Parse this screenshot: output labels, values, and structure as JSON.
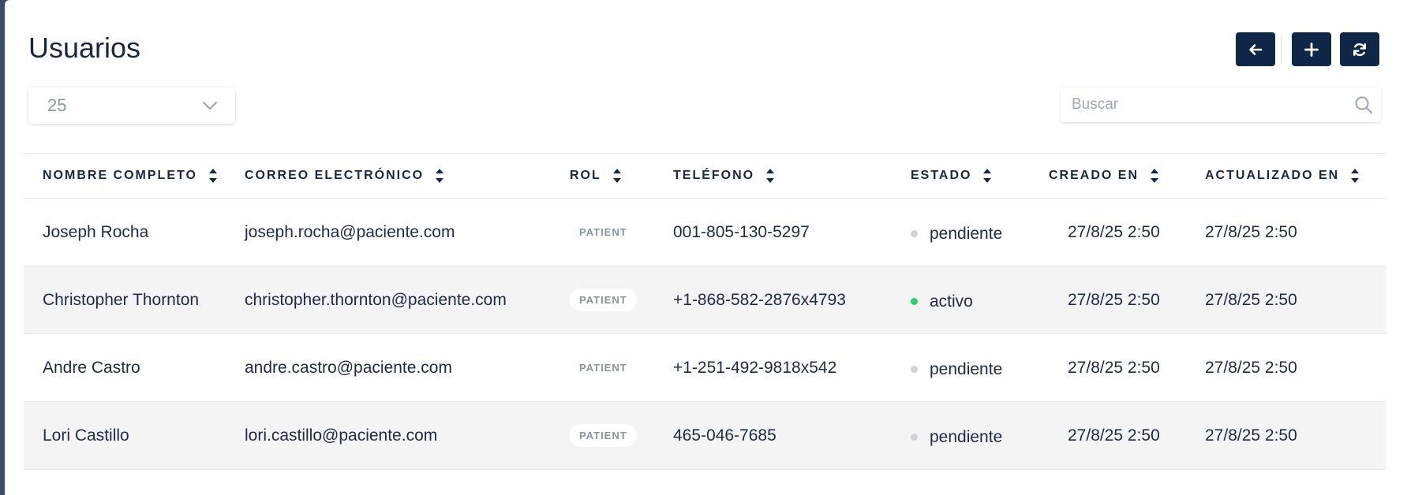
{
  "header": {
    "title": "Usuarios"
  },
  "toolbar": {
    "back_icon": "arrow-left-icon",
    "add_icon": "plus-icon",
    "refresh_icon": "refresh-icon"
  },
  "page_size": {
    "value": "25"
  },
  "search": {
    "placeholder": "Buscar",
    "value": ""
  },
  "table": {
    "columns": [
      "NOMBRE COMPLETO",
      "CORREO ELECTRÓNICO",
      "ROL",
      "TELÉFONO",
      "ESTADO",
      "CREADO EN",
      "ACTUALIZADO EN"
    ],
    "rows": [
      {
        "name": "Joseph Rocha",
        "email": "joseph.rocha@paciente.com",
        "role": "PATIENT",
        "phone": "001-805-130-5297",
        "status": "pendiente",
        "created": "27/8/25 2:50",
        "updated": "27/8/25 2:50"
      },
      {
        "name": "Christopher Thornton",
        "email": "christopher.thornton@paciente.com",
        "role": "PATIENT",
        "phone": "+1-868-582-2876x4793",
        "status": "activo",
        "created": "27/8/25 2:50",
        "updated": "27/8/25 2:50"
      },
      {
        "name": "Andre Castro",
        "email": "andre.castro@paciente.com",
        "role": "PATIENT",
        "phone": "+1-251-492-9818x542",
        "status": "pendiente",
        "created": "27/8/25 2:50",
        "updated": "27/8/25 2:50"
      },
      {
        "name": "Lori Castillo",
        "email": "lori.castillo@paciente.com",
        "role": "PATIENT",
        "phone": "465-046-7685",
        "status": "pendiente",
        "created": "27/8/25 2:50",
        "updated": "27/8/25 2:50"
      }
    ]
  },
  "colors": {
    "primary": "#0f2647",
    "status_active": "#2ecc71",
    "status_pending": "#d0d3d8",
    "row_alt": "#f4f4f5"
  }
}
